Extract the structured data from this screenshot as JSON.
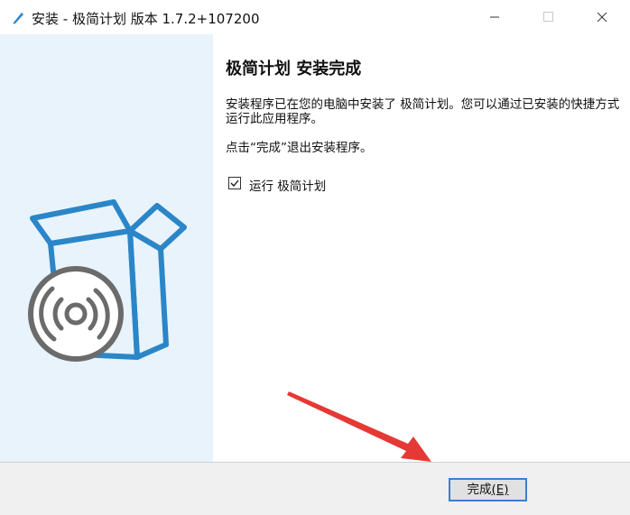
{
  "window": {
    "title": "安装 - 极简计划 版本 1.7.2+107200"
  },
  "content": {
    "heading": "极简计划 安装完成",
    "paragraph1": "安装程序已在您的电脑中安装了 极简计划。您可以通过已安装的快捷方式运行此应用程序。",
    "paragraph2": "点击“完成”退出安装程序。",
    "run_checkbox": {
      "label": "运行 极简计划",
      "checked": true
    }
  },
  "footer": {
    "finish_label": "完成",
    "finish_mnemonic": "(E)"
  },
  "colors": {
    "side_panel": "#e8f3fb",
    "illustration_blue": "#2b86c8",
    "disc_gray": "#6b6b6b",
    "arrow_red": "#e53935",
    "button_focus": "#3b7fd0"
  },
  "icons": {
    "app": "pen-icon",
    "minimize": "minimize-icon",
    "maximize": "maximize-icon",
    "close": "close-icon",
    "illustration": "box-with-disc-icon",
    "check": "checkmark-icon"
  }
}
